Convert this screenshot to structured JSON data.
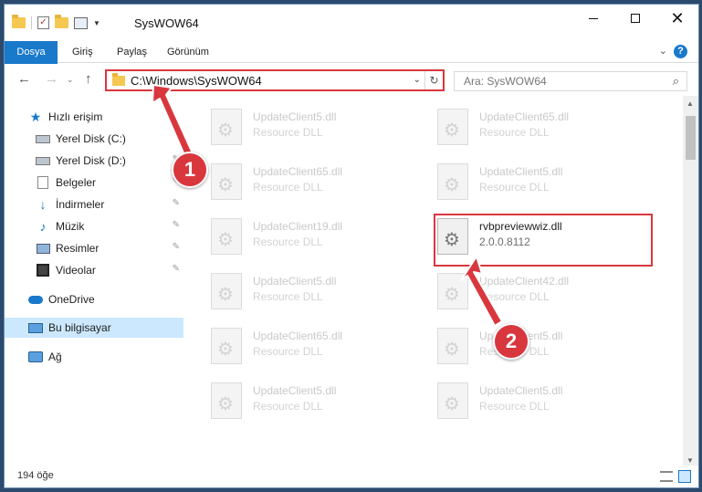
{
  "window": {
    "title": "SysWOW64",
    "minimize": "—",
    "maximize": "",
    "close": "✕"
  },
  "ribbon": {
    "tabs": [
      "Dosya",
      "Giriş",
      "Paylaş",
      "Görünüm"
    ],
    "expand": "⌄",
    "help": "?"
  },
  "nav": {
    "back": "←",
    "forward": "→",
    "recent": "⌄",
    "up": "↑",
    "address": "C:\\Windows\\SysWOW64",
    "address_dropdown": "⌄",
    "refresh": "↻",
    "search_placeholder": "Ara: SysWOW64",
    "search_icon": "⌕"
  },
  "sidebar": {
    "items": [
      {
        "label": "Hızlı erişim",
        "icon": "star-icon"
      },
      {
        "label": "Yerel Disk (C:)",
        "icon": "drive-icon"
      },
      {
        "label": "Yerel Disk (D:)",
        "icon": "drive-icon"
      },
      {
        "label": "Belgeler",
        "icon": "documents-icon"
      },
      {
        "label": "İndirmeler",
        "icon": "download-icon"
      },
      {
        "label": "Müzik",
        "icon": "music-icon"
      },
      {
        "label": "Resimler",
        "icon": "pictures-icon"
      },
      {
        "label": "Videolar",
        "icon": "videos-icon"
      },
      {
        "label": "OneDrive",
        "icon": "cloud-icon"
      },
      {
        "label": "Bu bilgisayar",
        "icon": "computer-icon"
      },
      {
        "label": "Ağ",
        "icon": "network-icon"
      }
    ],
    "pin": "📌"
  },
  "files": [
    {
      "name": "UpdateClient5.dll",
      "desc": "Resource DLL"
    },
    {
      "name": "UpdateClient65.dll",
      "desc": "Resource DLL"
    },
    {
      "name": "UpdateClient65.dll",
      "desc": "Resource DLL"
    },
    {
      "name": "UpdateClient5.dll",
      "desc": "Resource DLL"
    },
    {
      "name": "UpdateClient19.dll",
      "desc": "Resource DLL"
    },
    {
      "name": "rvbpreviewwiz.dll",
      "desc": "2.0.0.8112"
    },
    {
      "name": "UpdateClient5.dll",
      "desc": "Resource DLL"
    },
    {
      "name": "UpdateClient42.dll",
      "desc": "Resource DLL"
    },
    {
      "name": "UpdateClient65.dll",
      "desc": "Resource DLL"
    },
    {
      "name": "UpdateClient5.dll",
      "desc": "Resource DLL"
    },
    {
      "name": "UpdateClient5.dll",
      "desc": "Resource DLL"
    },
    {
      "name": "UpdateClient5.dll",
      "desc": "Resource DLL"
    }
  ],
  "status": {
    "item_count": "194 öğe"
  },
  "annotations": {
    "badge1": "1",
    "badge2": "2",
    "color": "#d9373e"
  },
  "colors": {
    "accent": "#1979ca",
    "selection": "#cce8ff",
    "highlight": "#d9373e"
  }
}
